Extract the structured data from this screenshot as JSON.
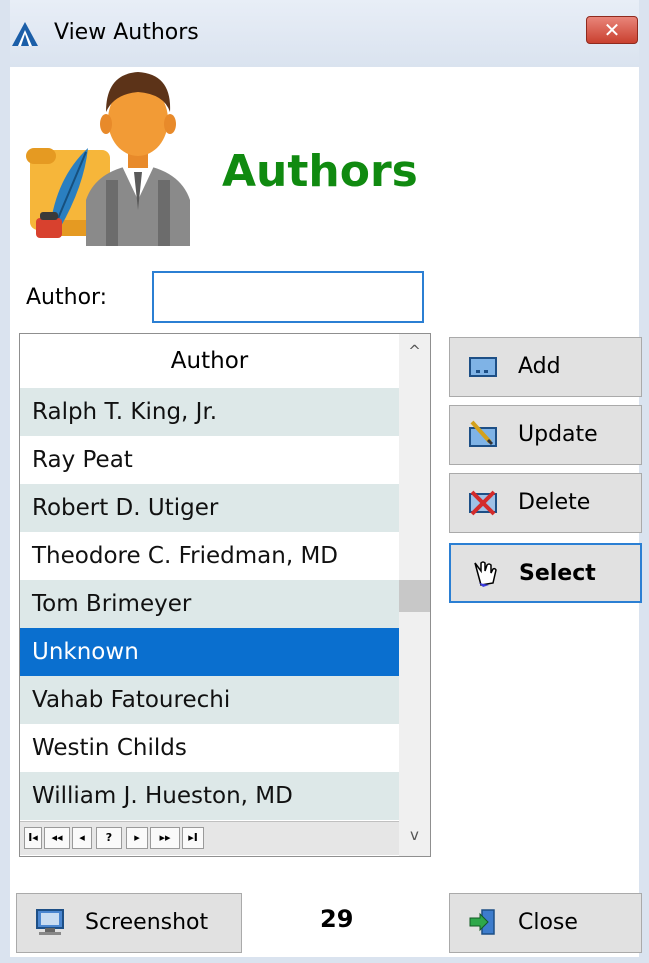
{
  "window": {
    "title": "View Authors",
    "close_glyph": "✕"
  },
  "header": {
    "title": "Authors",
    "logo_icon": "author-with-quill-icon"
  },
  "search": {
    "label": "Author:",
    "value": "",
    "placeholder": ""
  },
  "grid": {
    "column_header": "Author",
    "rows": [
      "Ralph T. King, Jr.",
      "Ray Peat",
      "Robert D. Utiger",
      "Theodore C. Friedman, MD",
      "Tom Brimeyer",
      "Unknown",
      "Vahab Fatourechi",
      "Westin Childs",
      "William J. Hueston, MD"
    ],
    "selected_row": "Unknown",
    "nav_buttons": [
      "I◂",
      "◂◂",
      "◂",
      "?",
      "▸",
      "▸▸",
      "▸I"
    ],
    "scroll_up": "^",
    "scroll_down": "v"
  },
  "actions": {
    "add": "Add",
    "update": "Update",
    "delete": "Delete",
    "select": "Select"
  },
  "footer": {
    "screenshot": "Screenshot",
    "count": "29",
    "close": "Close"
  },
  "colors": {
    "heading": "#108a10",
    "selection": "#0a6fcf",
    "alt_row": "#dde8e8",
    "focus": "#2b7fd3"
  }
}
